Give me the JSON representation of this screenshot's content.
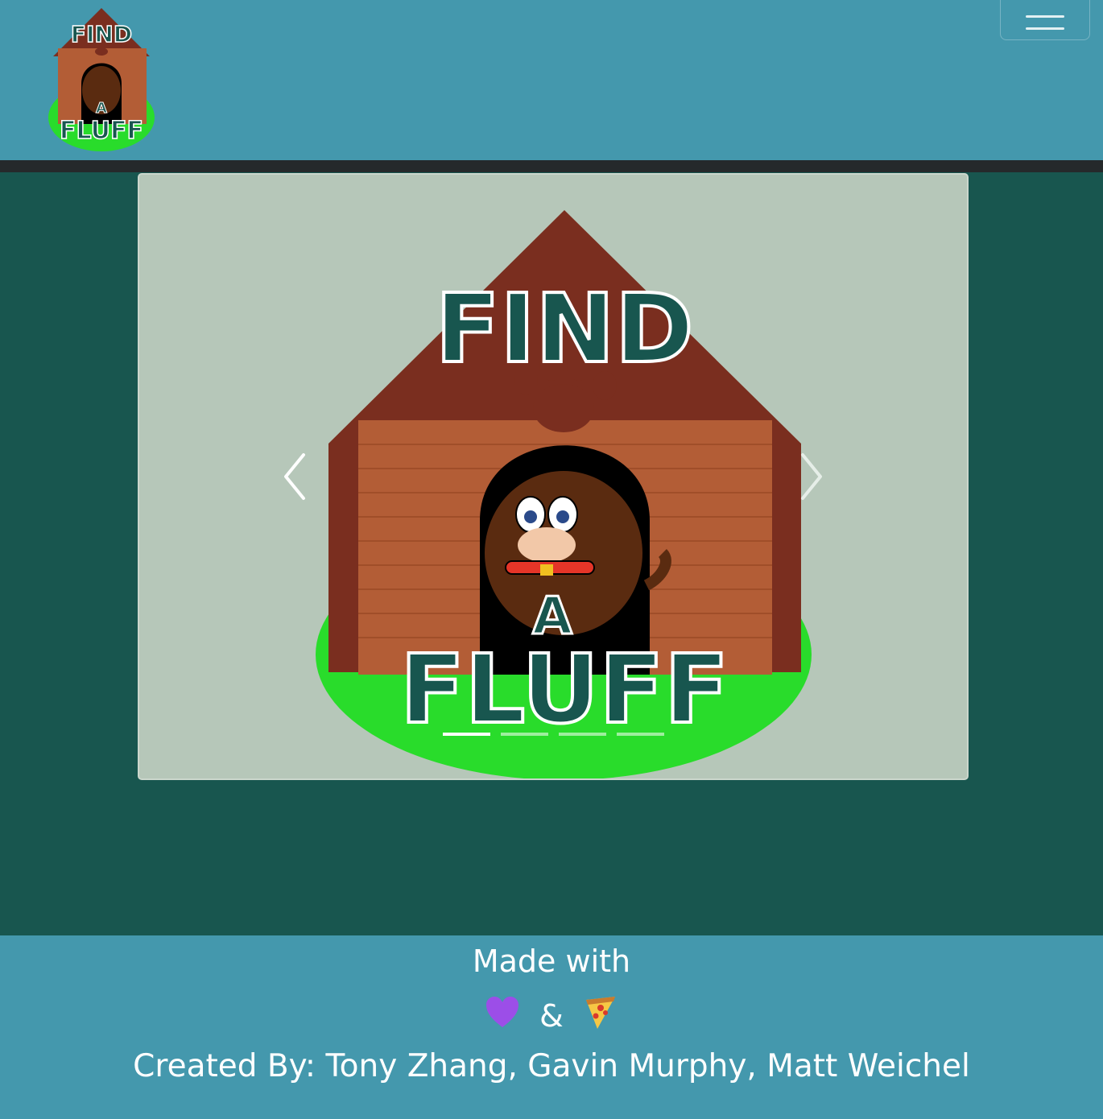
{
  "navbar": {
    "logo": {
      "top_text": "FIND",
      "middle_text": "A",
      "bottom_text": "FLUFF"
    },
    "menu_button_icon": "hamburger-icon"
  },
  "carousel": {
    "slide_logo": {
      "top_text": "FIND",
      "middle_text": "A",
      "bottom_text": "FLUFF"
    },
    "prev_icon": "chevron-left-icon",
    "next_icon": "chevron-right-icon",
    "slide_count": 4,
    "active_slide": 1
  },
  "footer": {
    "made_with": "Made with",
    "heart_icon": "purple-heart-icon",
    "ampersand": "&",
    "pizza_icon": "pizza-icon",
    "credits": "Created By: Tony Zhang, Gavin Murphy, Matt Weichel"
  },
  "colors": {
    "navbar": "#4498ad",
    "main_background": "#18564f",
    "divider": "#25292b",
    "carousel_background": "#b6c7b9",
    "text_primary": "#ffffff",
    "logo_text": "#18564f",
    "roof": "#7a2e1f",
    "wall": "#b35d36",
    "grass": "#29dc2b"
  }
}
